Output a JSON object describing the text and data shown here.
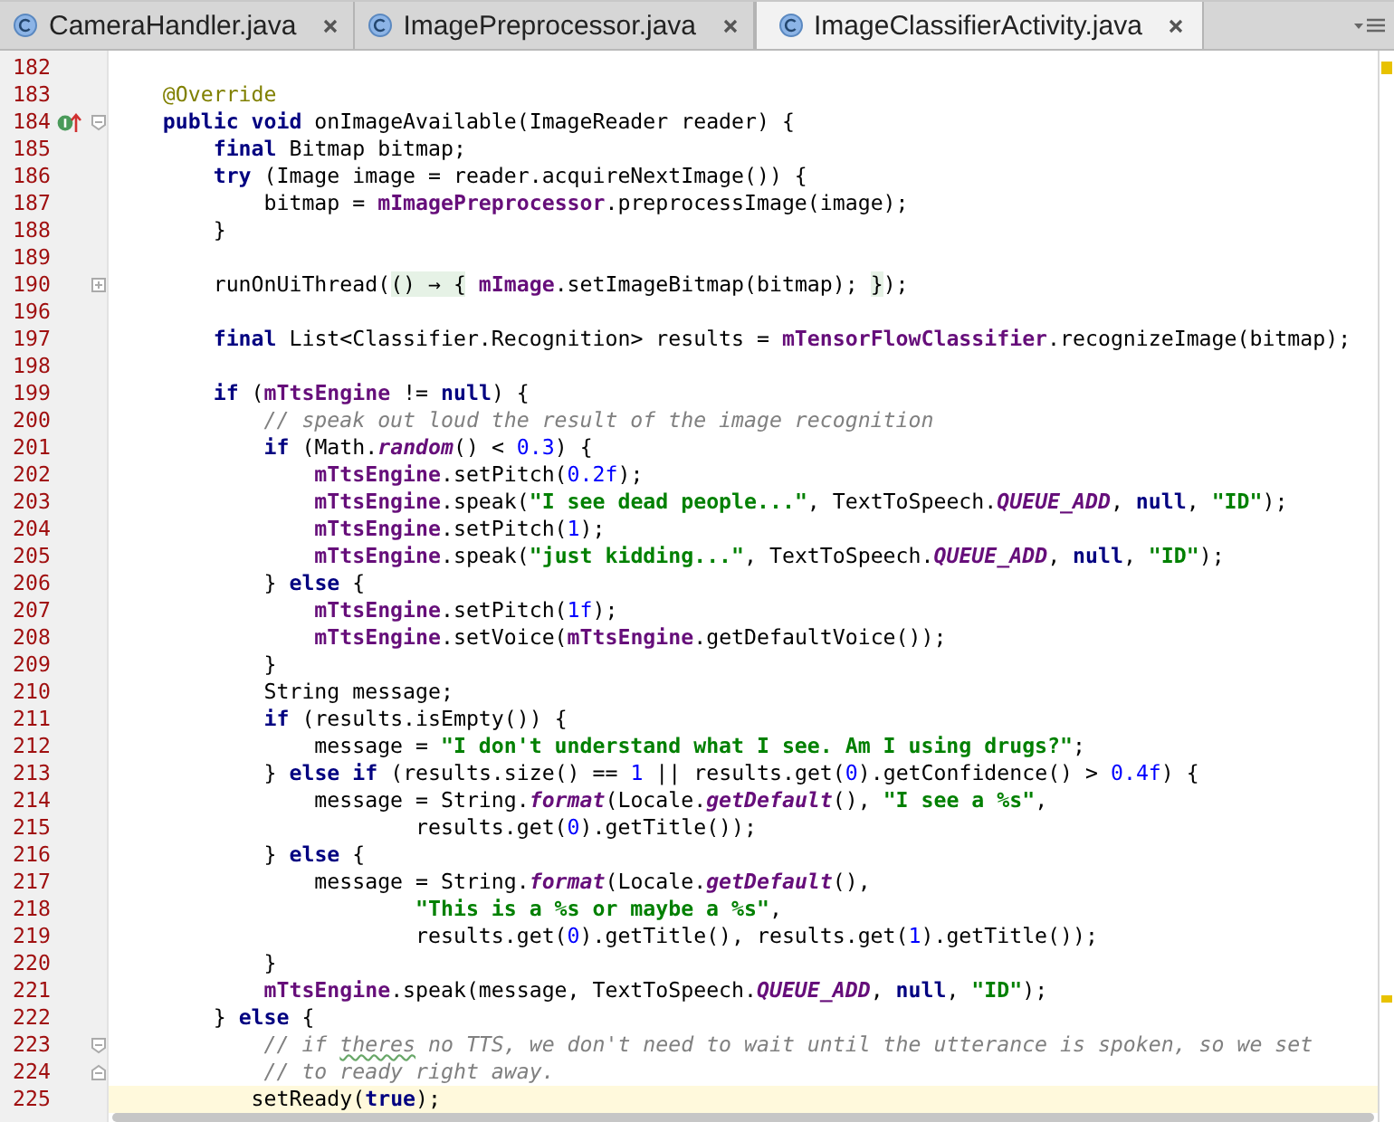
{
  "tabs": [
    {
      "label": "CameraHandler.java",
      "selected": false
    },
    {
      "label": "ImagePreprocessor.java",
      "selected": false
    },
    {
      "label": "ImageClassifierActivity.java",
      "selected": true
    }
  ],
  "editor": {
    "lines": [
      {
        "number": "182",
        "current": false
      },
      {
        "number": "183",
        "current": false,
        "tokens": [
          {
            "kind": "annotation",
            "text": "    @Override"
          }
        ]
      },
      {
        "number": "184",
        "current": false,
        "gutter_icons": [
          {
            "kind": "override"
          },
          {
            "kind": "fold-start"
          }
        ],
        "tokens": [
          {
            "kind": "keyword",
            "text": "    public void"
          },
          {
            "kind": "plain",
            "text": " onImageAvailable(ImageReader reader) {"
          }
        ]
      },
      {
        "number": "185",
        "current": false,
        "tokens": [
          {
            "kind": "keyword",
            "text": "        final"
          },
          {
            "kind": "plain",
            "text": " Bitmap bitmap;"
          }
        ]
      },
      {
        "number": "186",
        "current": false,
        "tokens": [
          {
            "kind": "keyword",
            "text": "        try"
          },
          {
            "kind": "plain",
            "text": " (Image image = reader.acquireNextImage()) {"
          }
        ]
      },
      {
        "number": "187",
        "current": false,
        "tokens": [
          {
            "kind": "plain",
            "text": "            bitmap = "
          },
          {
            "kind": "field",
            "text": "mImagePreprocessor"
          },
          {
            "kind": "plain",
            "text": ".preprocessImage(image);"
          }
        ]
      },
      {
        "number": "188",
        "current": false,
        "tokens": [
          {
            "kind": "plain",
            "text": "        }"
          }
        ]
      },
      {
        "number": "189",
        "current": false
      },
      {
        "number": "190",
        "current": false,
        "gutter_icons": [
          {
            "kind": "fold-collapsed"
          }
        ],
        "tokens": [
          {
            "kind": "plain",
            "text": "        runOnUiThread("
          },
          {
            "kind": "folded",
            "text": "() → {"
          },
          {
            "kind": "field",
            "text": " mImage"
          },
          {
            "kind": "plain",
            "text": ".setImageBitmap(bitmap); "
          },
          {
            "kind": "folded",
            "text": "}"
          },
          {
            "kind": "plain",
            "text": ");"
          }
        ]
      },
      {
        "number": "196",
        "current": false
      },
      {
        "number": "197",
        "current": false,
        "tokens": [
          {
            "kind": "keyword",
            "text": "        final"
          },
          {
            "kind": "plain",
            "text": " List<Classifier.Recognition> results = "
          },
          {
            "kind": "field",
            "text": "mTensorFlowClassifier"
          },
          {
            "kind": "plain",
            "text": ".recognizeImage(bitmap);"
          }
        ]
      },
      {
        "number": "198",
        "current": false
      },
      {
        "number": "199",
        "current": false,
        "tokens": [
          {
            "kind": "keyword",
            "text": "        if"
          },
          {
            "kind": "plain",
            "text": " ("
          },
          {
            "kind": "field",
            "text": "mTtsEngine"
          },
          {
            "kind": "plain",
            "text": " != "
          },
          {
            "kind": "keyword",
            "text": "null"
          },
          {
            "kind": "plain",
            "text": ") {"
          }
        ]
      },
      {
        "number": "200",
        "current": false,
        "tokens": [
          {
            "kind": "comment",
            "text": "            // speak out loud the result of the image recognition"
          }
        ]
      },
      {
        "number": "201",
        "current": false,
        "tokens": [
          {
            "kind": "keyword",
            "text": "            if"
          },
          {
            "kind": "plain",
            "text": " (Math."
          },
          {
            "kind": "static",
            "text": "random"
          },
          {
            "kind": "plain",
            "text": "() < "
          },
          {
            "kind": "number",
            "text": "0.3"
          },
          {
            "kind": "plain",
            "text": ") {"
          }
        ]
      },
      {
        "number": "202",
        "current": false,
        "tokens": [
          {
            "kind": "field",
            "text": "                mTtsEngine"
          },
          {
            "kind": "plain",
            "text": ".setPitch("
          },
          {
            "kind": "number",
            "text": "0.2f"
          },
          {
            "kind": "plain",
            "text": ");"
          }
        ]
      },
      {
        "number": "203",
        "current": false,
        "tokens": [
          {
            "kind": "field",
            "text": "                mTtsEngine"
          },
          {
            "kind": "plain",
            "text": ".speak("
          },
          {
            "kind": "string",
            "text": "\"I see dead people...\""
          },
          {
            "kind": "plain",
            "text": ", TextToSpeech."
          },
          {
            "kind": "static",
            "text": "QUEUE_ADD"
          },
          {
            "kind": "plain",
            "text": ", "
          },
          {
            "kind": "keyword",
            "text": "null"
          },
          {
            "kind": "plain",
            "text": ", "
          },
          {
            "kind": "string",
            "text": "\"ID\""
          },
          {
            "kind": "plain",
            "text": ");"
          }
        ]
      },
      {
        "number": "204",
        "current": false,
        "tokens": [
          {
            "kind": "field",
            "text": "                mTtsEngine"
          },
          {
            "kind": "plain",
            "text": ".setPitch("
          },
          {
            "kind": "number",
            "text": "1"
          },
          {
            "kind": "plain",
            "text": ");"
          }
        ]
      },
      {
        "number": "205",
        "current": false,
        "tokens": [
          {
            "kind": "field",
            "text": "                mTtsEngine"
          },
          {
            "kind": "plain",
            "text": ".speak("
          },
          {
            "kind": "string",
            "text": "\"just kidding...\""
          },
          {
            "kind": "plain",
            "text": ", TextToSpeech."
          },
          {
            "kind": "static",
            "text": "QUEUE_ADD"
          },
          {
            "kind": "plain",
            "text": ", "
          },
          {
            "kind": "keyword",
            "text": "null"
          },
          {
            "kind": "plain",
            "text": ", "
          },
          {
            "kind": "string",
            "text": "\"ID\""
          },
          {
            "kind": "plain",
            "text": ");"
          }
        ]
      },
      {
        "number": "206",
        "current": false,
        "tokens": [
          {
            "kind": "plain",
            "text": "            } "
          },
          {
            "kind": "keyword",
            "text": "else"
          },
          {
            "kind": "plain",
            "text": " {"
          }
        ]
      },
      {
        "number": "207",
        "current": false,
        "tokens": [
          {
            "kind": "field",
            "text": "                mTtsEngine"
          },
          {
            "kind": "plain",
            "text": ".setPitch("
          },
          {
            "kind": "number",
            "text": "1f"
          },
          {
            "kind": "plain",
            "text": ");"
          }
        ]
      },
      {
        "number": "208",
        "current": false,
        "tokens": [
          {
            "kind": "field",
            "text": "                mTtsEngine"
          },
          {
            "kind": "plain",
            "text": ".setVoice("
          },
          {
            "kind": "field",
            "text": "mTtsEngine"
          },
          {
            "kind": "plain",
            "text": ".getDefaultVoice());"
          }
        ]
      },
      {
        "number": "209",
        "current": false,
        "tokens": [
          {
            "kind": "plain",
            "text": "            }"
          }
        ]
      },
      {
        "number": "210",
        "current": false,
        "tokens": [
          {
            "kind": "plain",
            "text": "            String message;"
          }
        ]
      },
      {
        "number": "211",
        "current": false,
        "tokens": [
          {
            "kind": "keyword",
            "text": "            if"
          },
          {
            "kind": "plain",
            "text": " (results.isEmpty()) {"
          }
        ]
      },
      {
        "number": "212",
        "current": false,
        "tokens": [
          {
            "kind": "plain",
            "text": "                message = "
          },
          {
            "kind": "string",
            "text": "\"I don't understand what I see. Am I using drugs?\""
          },
          {
            "kind": "plain",
            "text": ";"
          }
        ]
      },
      {
        "number": "213",
        "current": false,
        "tokens": [
          {
            "kind": "plain",
            "text": "            } "
          },
          {
            "kind": "keyword",
            "text": "else if"
          },
          {
            "kind": "plain",
            "text": " (results.size() == "
          },
          {
            "kind": "number",
            "text": "1"
          },
          {
            "kind": "plain",
            "text": " || results.get("
          },
          {
            "kind": "number",
            "text": "0"
          },
          {
            "kind": "plain",
            "text": ").getConfidence() > "
          },
          {
            "kind": "number",
            "text": "0.4f"
          },
          {
            "kind": "plain",
            "text": ") {"
          }
        ]
      },
      {
        "number": "214",
        "current": false,
        "tokens": [
          {
            "kind": "plain",
            "text": "                message = String."
          },
          {
            "kind": "static",
            "text": "format"
          },
          {
            "kind": "plain",
            "text": "(Locale."
          },
          {
            "kind": "static",
            "text": "getDefault"
          },
          {
            "kind": "plain",
            "text": "(), "
          },
          {
            "kind": "string",
            "text": "\"I see a %s\""
          },
          {
            "kind": "plain",
            "text": ","
          }
        ]
      },
      {
        "number": "215",
        "current": false,
        "tokens": [
          {
            "kind": "plain",
            "text": "                        results.get("
          },
          {
            "kind": "number",
            "text": "0"
          },
          {
            "kind": "plain",
            "text": ").getTitle());"
          }
        ]
      },
      {
        "number": "216",
        "current": false,
        "tokens": [
          {
            "kind": "plain",
            "text": "            } "
          },
          {
            "kind": "keyword",
            "text": "else"
          },
          {
            "kind": "plain",
            "text": " {"
          }
        ]
      },
      {
        "number": "217",
        "current": false,
        "tokens": [
          {
            "kind": "plain",
            "text": "                message = String."
          },
          {
            "kind": "static",
            "text": "format"
          },
          {
            "kind": "plain",
            "text": "(Locale."
          },
          {
            "kind": "static",
            "text": "getDefault"
          },
          {
            "kind": "plain",
            "text": "(),"
          }
        ]
      },
      {
        "number": "218",
        "current": false,
        "tokens": [
          {
            "kind": "string",
            "text": "                        \"This is a %s or maybe a %s\""
          },
          {
            "kind": "plain",
            "text": ","
          }
        ]
      },
      {
        "number": "219",
        "current": false,
        "tokens": [
          {
            "kind": "plain",
            "text": "                        results.get("
          },
          {
            "kind": "number",
            "text": "0"
          },
          {
            "kind": "plain",
            "text": ").getTitle(), results.get("
          },
          {
            "kind": "number",
            "text": "1"
          },
          {
            "kind": "plain",
            "text": ").getTitle());"
          }
        ]
      },
      {
        "number": "220",
        "current": false,
        "tokens": [
          {
            "kind": "plain",
            "text": "            }"
          }
        ]
      },
      {
        "number": "221",
        "current": false,
        "tokens": [
          {
            "kind": "field",
            "text": "            mTtsEngine"
          },
          {
            "kind": "plain",
            "text": ".speak(message, TextToSpeech."
          },
          {
            "kind": "static",
            "text": "QUEUE_ADD"
          },
          {
            "kind": "plain",
            "text": ", "
          },
          {
            "kind": "keyword",
            "text": "null"
          },
          {
            "kind": "plain",
            "text": ", "
          },
          {
            "kind": "string",
            "text": "\"ID\""
          },
          {
            "kind": "plain",
            "text": ");"
          }
        ]
      },
      {
        "number": "222",
        "current": false,
        "tokens": [
          {
            "kind": "plain",
            "text": "        } "
          },
          {
            "kind": "keyword",
            "text": "else"
          },
          {
            "kind": "plain",
            "text": " {"
          }
        ]
      },
      {
        "number": "223",
        "current": false,
        "gutter_icons": [
          {
            "kind": "fold-start"
          }
        ],
        "tokens": [
          {
            "kind": "comment",
            "text": "            // if "
          },
          {
            "kind": "typo",
            "text": "theres"
          },
          {
            "kind": "comment",
            "text": " no TTS, we don't need to wait until the utterance is spoken, so we set"
          }
        ]
      },
      {
        "number": "224",
        "current": false,
        "gutter_icons": [
          {
            "kind": "fold-end"
          }
        ],
        "tokens": [
          {
            "kind": "comment",
            "text": "            // to ready right away."
          }
        ]
      },
      {
        "number": "225",
        "current": true,
        "tokens": [
          {
            "kind": "plain",
            "text": "           setReady("
          },
          {
            "kind": "keyword",
            "text": "true"
          },
          {
            "kind": "plain",
            "text": ");"
          }
        ]
      }
    ]
  }
}
